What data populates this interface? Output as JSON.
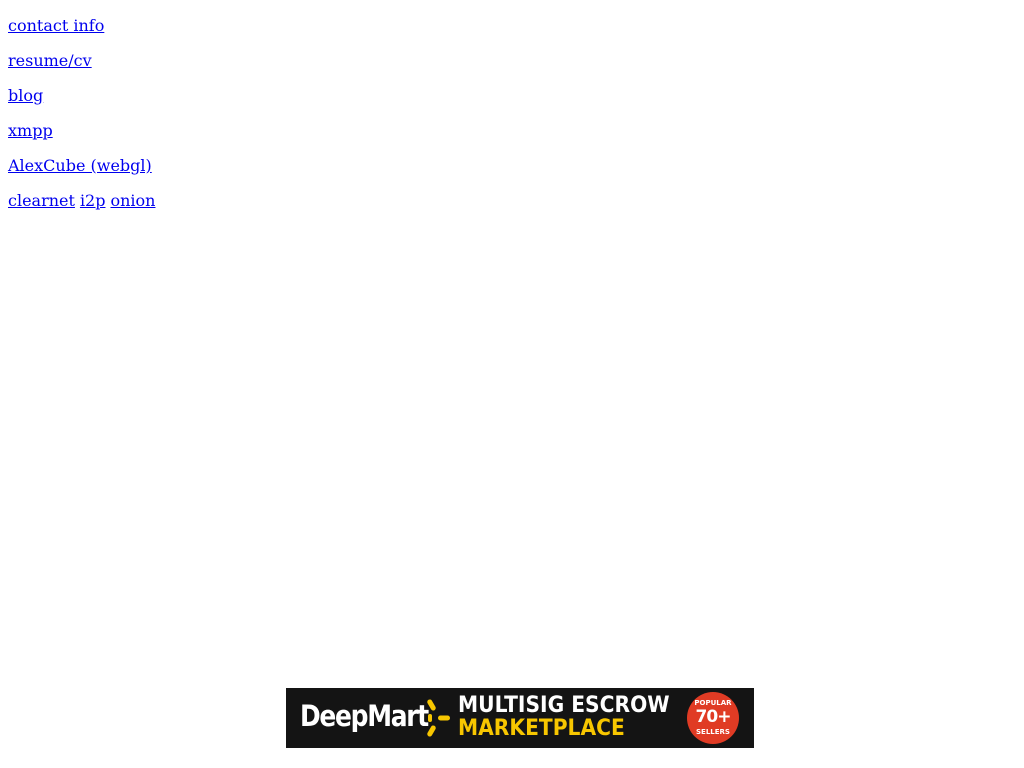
{
  "links": {
    "contact": "contact info",
    "resume": "resume/cv",
    "blog": "blog",
    "xmpp": "xmpp",
    "alexcube": "AlexCube (webgl)",
    "mirrors": {
      "clearnet": "clearnet",
      "i2p": "i2p",
      "onion": "onion"
    }
  },
  "banner": {
    "brand": "DeepMart",
    "line1": "MULTISIG ESCROW",
    "line2": "MARKETPLACE",
    "badge_top": "POPULAR",
    "badge_number": "70+",
    "badge_bottom": "SELLERS",
    "spark_icon": "spark-icon",
    "colors": {
      "background": "#141414",
      "accent": "#f7c600",
      "badge": "#e03b24"
    }
  }
}
